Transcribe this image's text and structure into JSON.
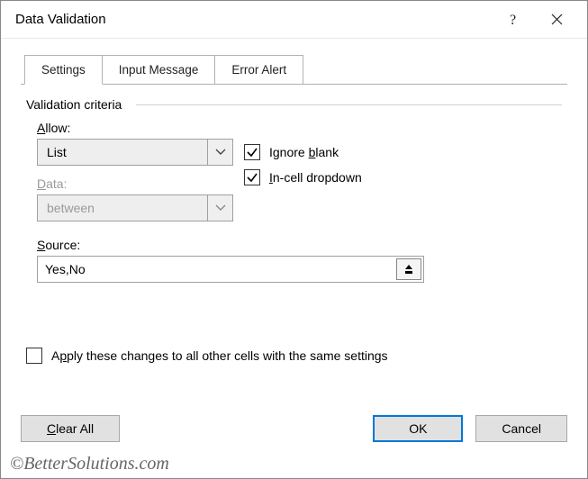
{
  "titlebar": {
    "title": "Data Validation"
  },
  "tabs": {
    "settings": "Settings",
    "input_message": "Input Message",
    "error_alert": "Error Alert"
  },
  "panel": {
    "legend": "Validation criteria",
    "allow_label": "Allow:",
    "allow_value": "List",
    "data_label": "Data:",
    "data_value": "between",
    "ignore_blank": "Ignore blank",
    "incell_dropdown": "In-cell dropdown",
    "source_label": "Source:",
    "source_value": "Yes,No",
    "apply_label": "Apply these changes to all other cells with the same settings"
  },
  "buttons": {
    "clear_all": "Clear All",
    "ok": "OK",
    "cancel": "Cancel"
  },
  "watermark": "©BetterSolutions.com"
}
